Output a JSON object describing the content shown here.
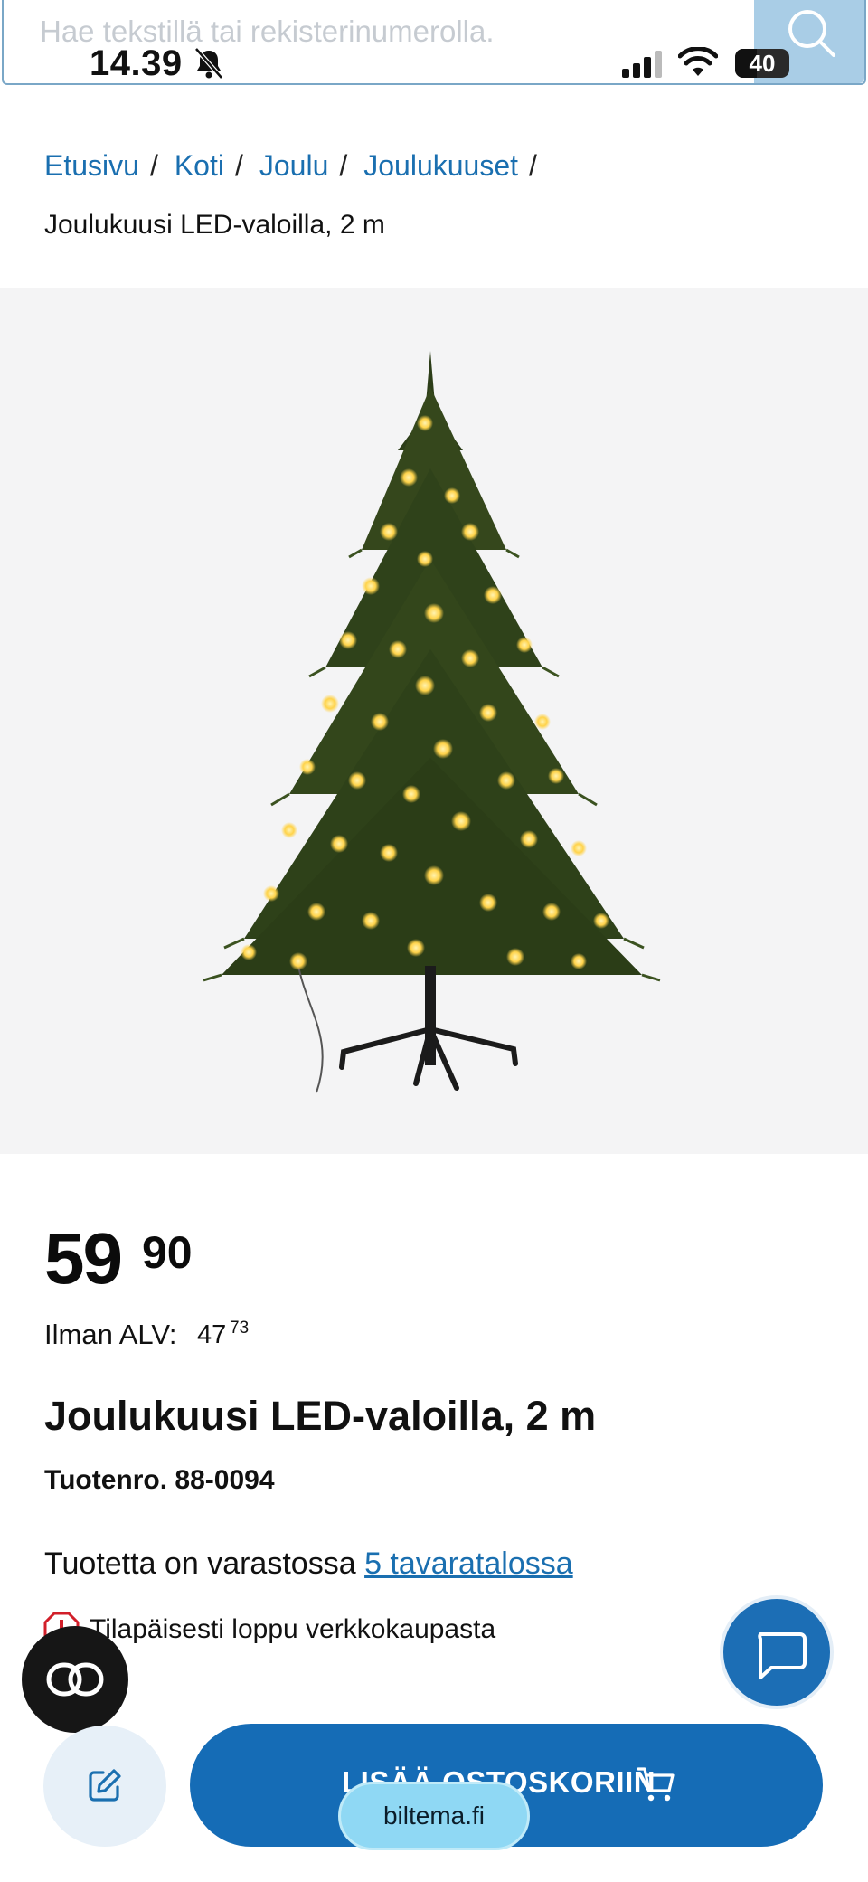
{
  "status_bar": {
    "time": "14.39",
    "battery": "40",
    "battery_level": 0.4
  },
  "search": {
    "placeholder": "Hae tekstillä tai rekisterinumerolla."
  },
  "breadcrumb": {
    "items": [
      "Etusivu",
      "Koti",
      "Joulu",
      "Joulukuuset"
    ],
    "separator": "/",
    "current": "Joulukuusi LED-valoilla, 2 m"
  },
  "product": {
    "price_main": "59",
    "price_cents": "90",
    "vat_label": "Ilman ALV:",
    "vat_main": "47",
    "vat_cents": "73",
    "title": "Joulukuusi LED-valoilla, 2 m",
    "number": "Tuotenro. 88-0094",
    "stock_prefix": "Tuotetta on varastossa",
    "stock_link": "5 tavaratalossa",
    "notice": "Tilapäisesti loppu verkkokaupasta"
  },
  "actions": {
    "add_to_cart": "LISÄÄ OSTOSKORIIN"
  },
  "browser": {
    "url": "biltema.fi"
  },
  "colors": {
    "link": "#1a6fb0",
    "primary_button": "#156cb6",
    "chat_button": "#1c6eb5",
    "notice_red": "#d21f2a",
    "image_bg": "#f4f4f5"
  }
}
